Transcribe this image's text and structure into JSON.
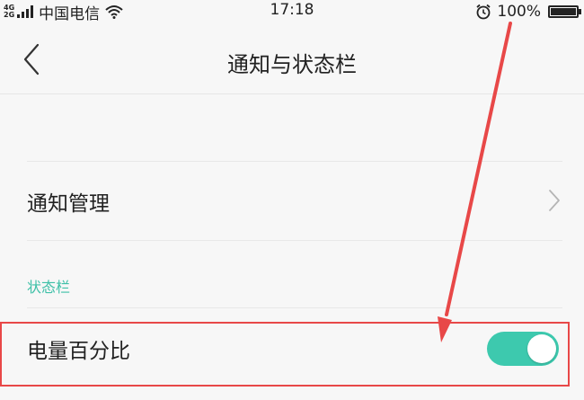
{
  "status_bar": {
    "network_top": "4G",
    "network_bottom": "2G",
    "carrier": "中国电信",
    "time": "17:18",
    "battery_percent": "100%",
    "icons": [
      "signal-icon",
      "wifi-icon",
      "alarm-icon",
      "battery-icon"
    ]
  },
  "header": {
    "title": "通知与状态栏",
    "back_icon": "chevron-left-icon"
  },
  "list": {
    "notification_management": "通知管理",
    "section_status_bar": "状态栏",
    "battery_percentage": "电量百分比",
    "battery_percentage_toggle_on": true
  },
  "colors": {
    "accent": "#3dc9ae",
    "section_text": "#3fc0a8",
    "annotation_red": "#e84848",
    "background": "#f7f7f7"
  }
}
